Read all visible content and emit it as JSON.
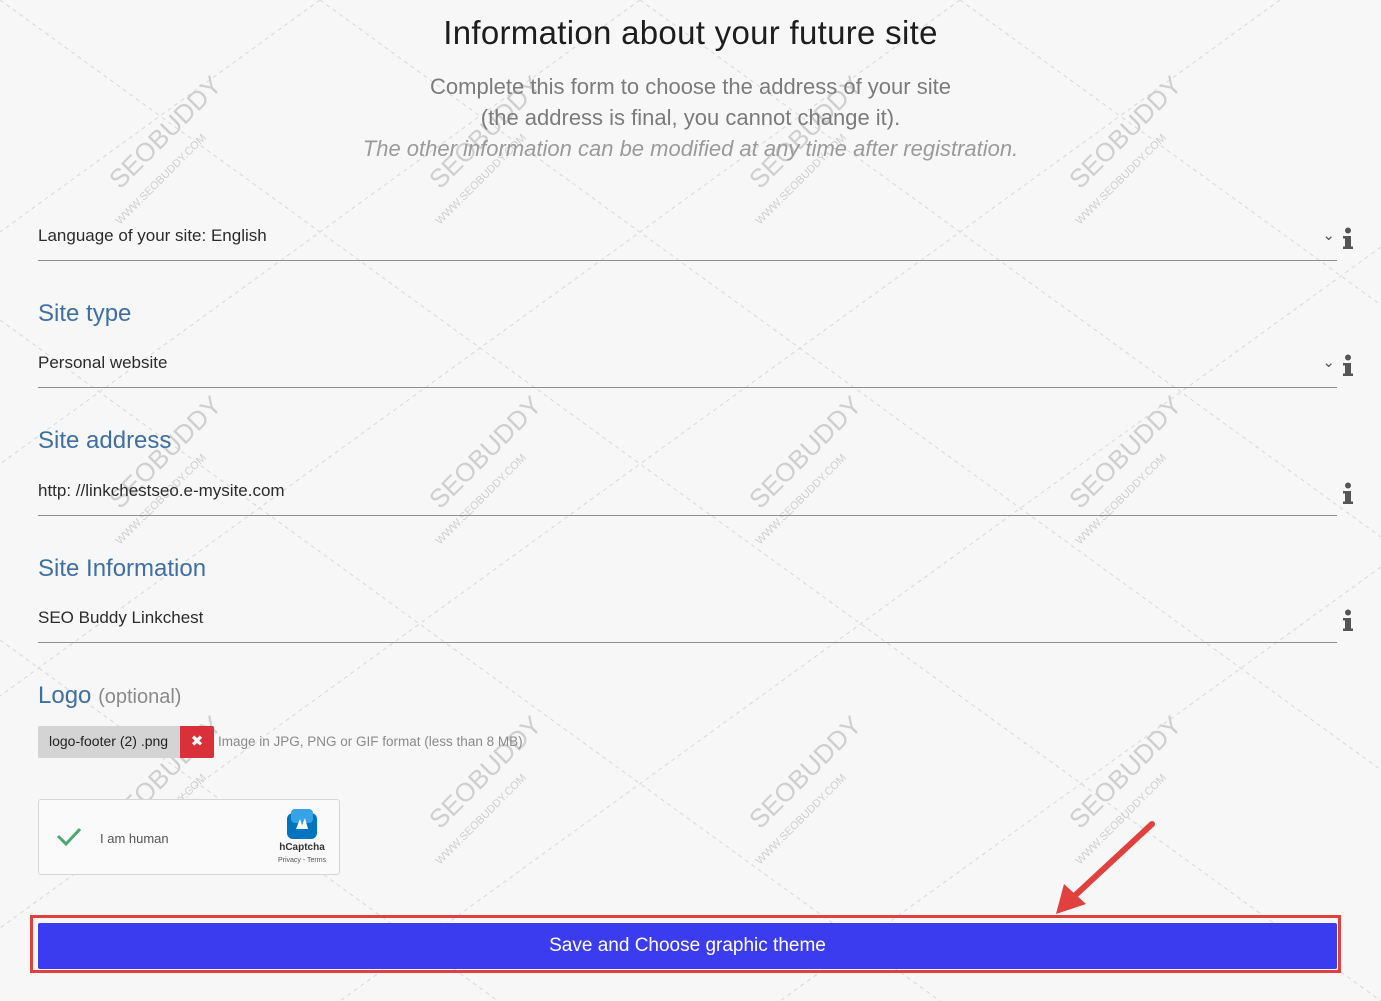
{
  "header": {
    "title": "Information about your future site",
    "subtitle_line1": "Complete this form to choose the address of your site",
    "subtitle_line2": "(the address is final, you cannot change it).",
    "subtitle_line3": "The other information can be modified at any time after registration."
  },
  "language": {
    "value": "Language of your site: English"
  },
  "site_type": {
    "label": "Site type",
    "value": "Personal website"
  },
  "site_address": {
    "label": "Site address",
    "value": "http: //linkchestseo.e-mysite.com"
  },
  "site_information": {
    "label": "Site Information",
    "value": "SEO Buddy Linkchest"
  },
  "logo": {
    "label": "Logo",
    "optional": "(optional)",
    "file_name": "logo-footer (2) .png",
    "hint": "Image in JPG, PNG or GIF format (less than 8 MB)"
  },
  "captcha": {
    "label": "I am human",
    "brand": "hCaptcha",
    "links": "Privacy - Terms"
  },
  "actions": {
    "save_label": "Save and Choose graphic theme"
  },
  "icons": {
    "info": "info-icon",
    "dropdown": "chevron-down-icon",
    "remove": "close-icon",
    "check": "check-icon"
  },
  "colors": {
    "accent": "#3b3cf0",
    "section_label": "#3f6fa3",
    "remove": "#d9303a",
    "highlight": "#e0413e"
  },
  "watermark": {
    "brand": "SEOBUDDY",
    "url": "WWW.SEOBUDDY.COM"
  }
}
